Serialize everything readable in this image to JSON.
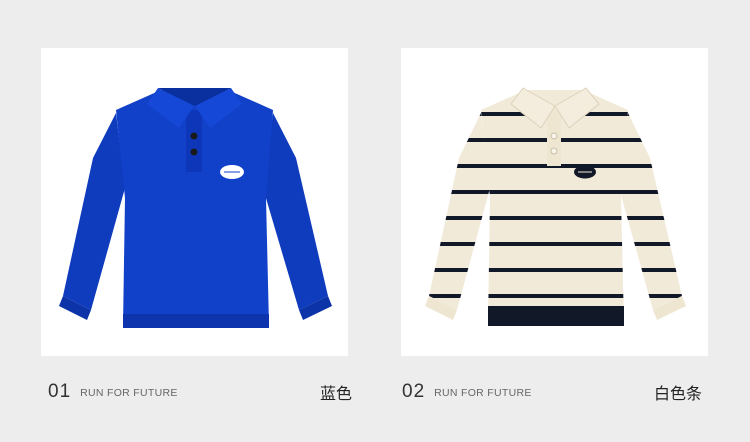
{
  "products": [
    {
      "number": "01",
      "tagline": "RUN FOR FUTURE",
      "color_name": "蓝色",
      "image_icon": "blue-polo-sweater",
      "main_color": "#1140c9",
      "shade_color": "#0d34ad"
    },
    {
      "number": "02",
      "tagline": "RUN FOR FUTURE",
      "color_name": "白色条",
      "image_icon": "cream-striped-polo-sweater",
      "main_color": "#f2ead8",
      "stripe_color": "#111827"
    }
  ]
}
